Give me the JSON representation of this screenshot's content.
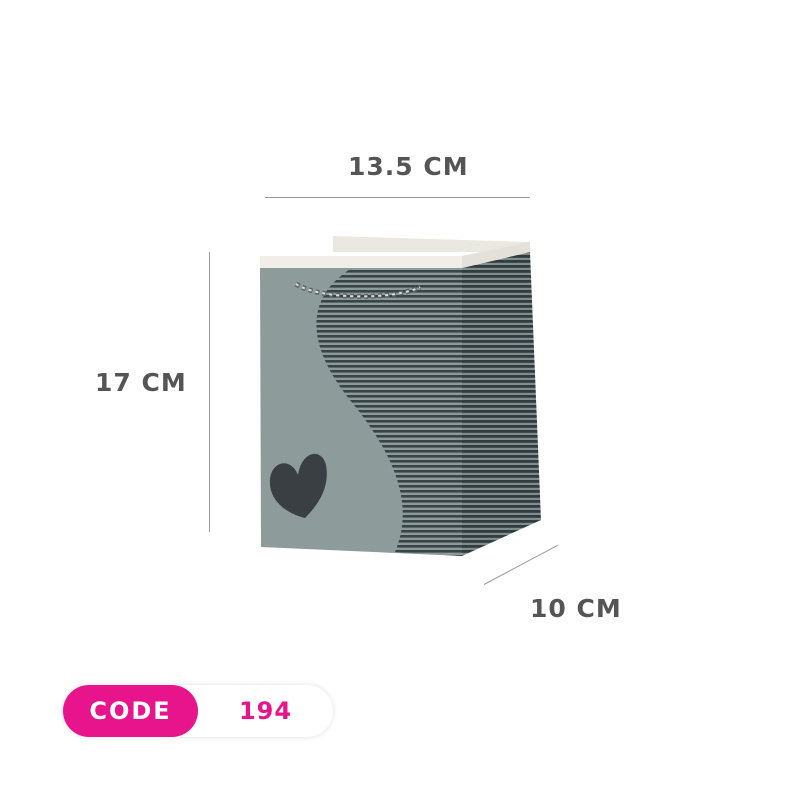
{
  "dimensions": {
    "width": "13.5 CM",
    "height": "17 CM",
    "depth": "10 CM"
  },
  "code": {
    "label": "CODE",
    "value": "194"
  },
  "colors": {
    "accent": "#e8148c",
    "bag_front": "#8a9898",
    "bag_side": "#3f4a4c",
    "heart": "#3a4044",
    "label_text": "#555555"
  }
}
